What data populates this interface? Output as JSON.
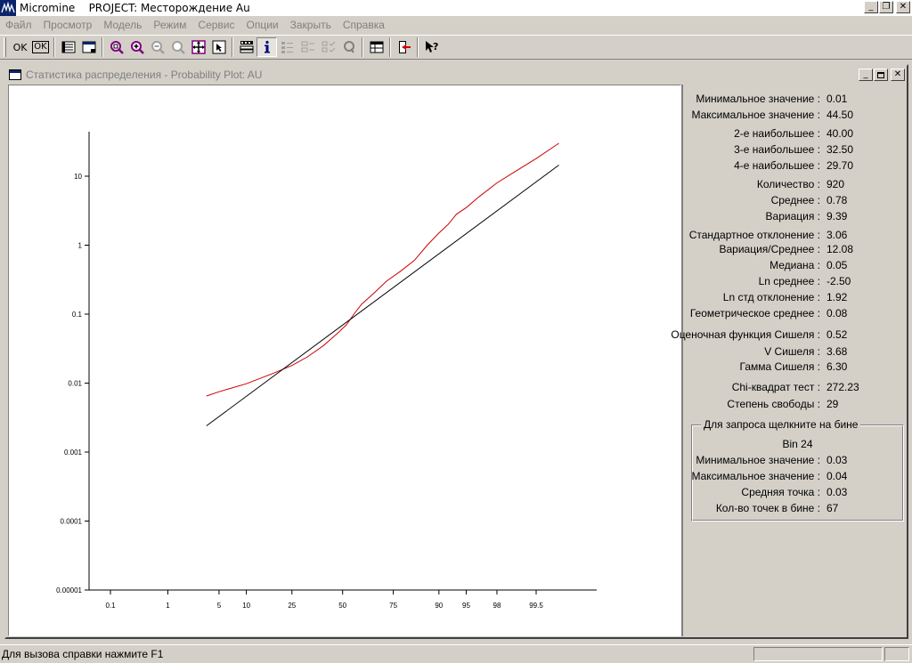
{
  "app": {
    "title": "Micromine    PROJECT: Месторождение Au",
    "logo_icon": "micromine-logo-icon"
  },
  "window_controls": {
    "minimize": "_",
    "restore": "❐",
    "close": "✕"
  },
  "menu": [
    {
      "label": "Файл"
    },
    {
      "label": "Просмотр"
    },
    {
      "label": "Модель"
    },
    {
      "label": "Режим"
    },
    {
      "label": "Сервис"
    },
    {
      "label": "Опции"
    },
    {
      "label": "Закрыть"
    },
    {
      "label": "Справка"
    }
  ],
  "toolbar": {
    "ok_label": "OK",
    "ok_boxed_label": "OK"
  },
  "child_window": {
    "title": "Статистика распределения - Probability Plot: AU"
  },
  "chart_data": {
    "type": "line",
    "title": "",
    "xlabel": "",
    "ylabel": "",
    "y_scale": "log",
    "x_scale": "probability",
    "x_ticks": [
      "0.1",
      "1",
      "5",
      "10",
      "25",
      "50",
      "75",
      "90",
      "95",
      "98",
      "99.5"
    ],
    "y_ticks": [
      "0.00001",
      "0.0001",
      "0.001",
      "0.01",
      "0.1",
      "1",
      "10"
    ],
    "ylim": [
      1e-05,
      45
    ],
    "series": [
      {
        "color": "#cc0000",
        "x": [
          3.5,
          5,
          10,
          18,
          25,
          32,
          40,
          48,
          52,
          56,
          60,
          66,
          72,
          78,
          83,
          87,
          90,
          92,
          93.5,
          95,
          96.5,
          98,
          98.8,
          99.5,
          99.8
        ],
        "y": [
          0.0065,
          0.0075,
          0.0098,
          0.014,
          0.018,
          0.024,
          0.035,
          0.055,
          0.07,
          0.1,
          0.14,
          0.2,
          0.3,
          0.42,
          0.6,
          1.0,
          1.5,
          2.0,
          2.8,
          3.5,
          5.0,
          8.0,
          11.0,
          18.0,
          30.0
        ]
      },
      {
        "color": "#000000",
        "x": [
          3.5,
          99.8
        ],
        "y": [
          0.0024,
          14.5
        ]
      }
    ]
  },
  "stats": [
    {
      "label": "Минимальное значение :",
      "value": "0.01"
    },
    {
      "label": "Максимальное значение :",
      "value": "44.50"
    },
    {
      "label": "2-е наибольшее :",
      "value": "40.00"
    },
    {
      "label": "3-е наибольшее :",
      "value": "32.50"
    },
    {
      "label": "4-е наибольшее :",
      "value": "29.70"
    },
    {
      "label": "Количество :",
      "value": "920"
    },
    {
      "label": "Среднее :",
      "value": "0.78"
    },
    {
      "label": "Вариация :",
      "value": "9.39"
    },
    {
      "label": "Стандартное отклонение :",
      "value": "3.06"
    },
    {
      "label": "Вариация/Среднее :",
      "value": "12.08"
    },
    {
      "label": "Медиана :",
      "value": "0.05"
    },
    {
      "label": "Ln среднее :",
      "value": "-2.50"
    },
    {
      "label": "Ln стд отклонение :",
      "value": "1.92"
    },
    {
      "label": "Геометрическое среднее :",
      "value": "0.08"
    },
    {
      "label": "Оценочная функция Сишеля :",
      "value": "0.52"
    },
    {
      "label": "V Сишеля :",
      "value": "3.68"
    },
    {
      "label": "Гамма Сишеля :",
      "value": "6.30"
    },
    {
      "label": "Chi-квадрат тест :",
      "value": "272.23"
    },
    {
      "label": "Степень свободы :",
      "value": "29"
    }
  ],
  "bin_group": {
    "legend": "Для запроса щелкните на бине",
    "bin_label": "Bin 24",
    "rows": [
      {
        "label": "Минимальное значение :",
        "value": "0.03"
      },
      {
        "label": "Максимальное значение :",
        "value": "0.04"
      },
      {
        "label": "Средняя точка :",
        "value": "0.03"
      },
      {
        "label": "Кол-во точек в бине :",
        "value": "67"
      }
    ]
  },
  "status": {
    "text": "Для вызова справки нажмите F1"
  }
}
